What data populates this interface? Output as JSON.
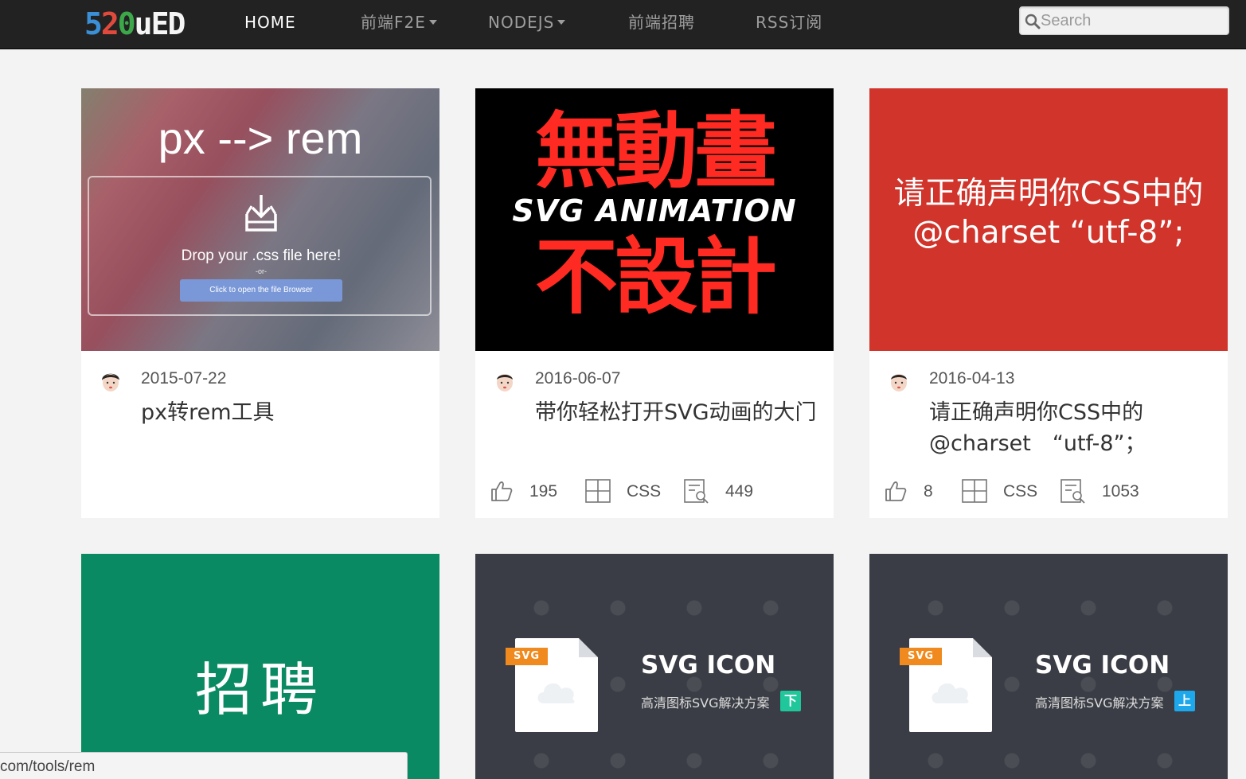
{
  "logo": {
    "chars": [
      "5",
      "2",
      "0",
      "u",
      "E",
      "D"
    ],
    "colors": [
      "#3a8fd6",
      "#e04a3c",
      "#3ca84a",
      "#f5f5f5",
      "#f5f5f5",
      "#f5f5f5"
    ]
  },
  "nav": {
    "items": [
      {
        "label": "HOME",
        "dropdown": false
      },
      {
        "label": "前端F2E",
        "dropdown": true
      },
      {
        "label": "NODEJS",
        "dropdown": true
      },
      {
        "label": "前端招聘",
        "dropdown": false
      },
      {
        "label": "RSS订阅",
        "dropdown": false
      }
    ],
    "search": {
      "placeholder": "Search",
      "icon": "search-icon"
    }
  },
  "cards": [
    {
      "thumb": {
        "heading": "px --> rem",
        "drop_text": "Drop your .css file here!",
        "or_text": "-or-",
        "button_label": "Click to open the file Browser"
      },
      "date": "2015-07-22",
      "title": "px转rem工具"
    },
    {
      "thumb": {
        "line1": "無動畫",
        "line2": "SVG ANIMATION",
        "line3": "不設計"
      },
      "date": "2016-06-07",
      "title": "带你轻松打开SVG动画的大门",
      "likes": "195",
      "category": "CSS",
      "views": "449"
    },
    {
      "thumb": {
        "line1": "请正确声明你CSS中的",
        "line2": "@charset “utf-8”;"
      },
      "date": "2016-04-13",
      "title": "请正确声明你CSS中的@charset　“utf-8”；",
      "likes": "8",
      "category": "CSS",
      "views": "1053"
    },
    {
      "thumb": {
        "text": "招聘"
      }
    },
    {
      "thumb": {
        "tag": "SVG",
        "title": "SVG ICON",
        "subtitle": "高清图标SVG解决方案",
        "badge": "下",
        "badge_color": "#1fc79b"
      }
    },
    {
      "thumb": {
        "tag": "SVG",
        "title": "SVG ICON",
        "subtitle": "高清图标SVG解决方案",
        "badge": "上",
        "badge_color": "#1ea8ec"
      }
    }
  ],
  "status_bar": {
    "url": "com/tools/rem"
  }
}
